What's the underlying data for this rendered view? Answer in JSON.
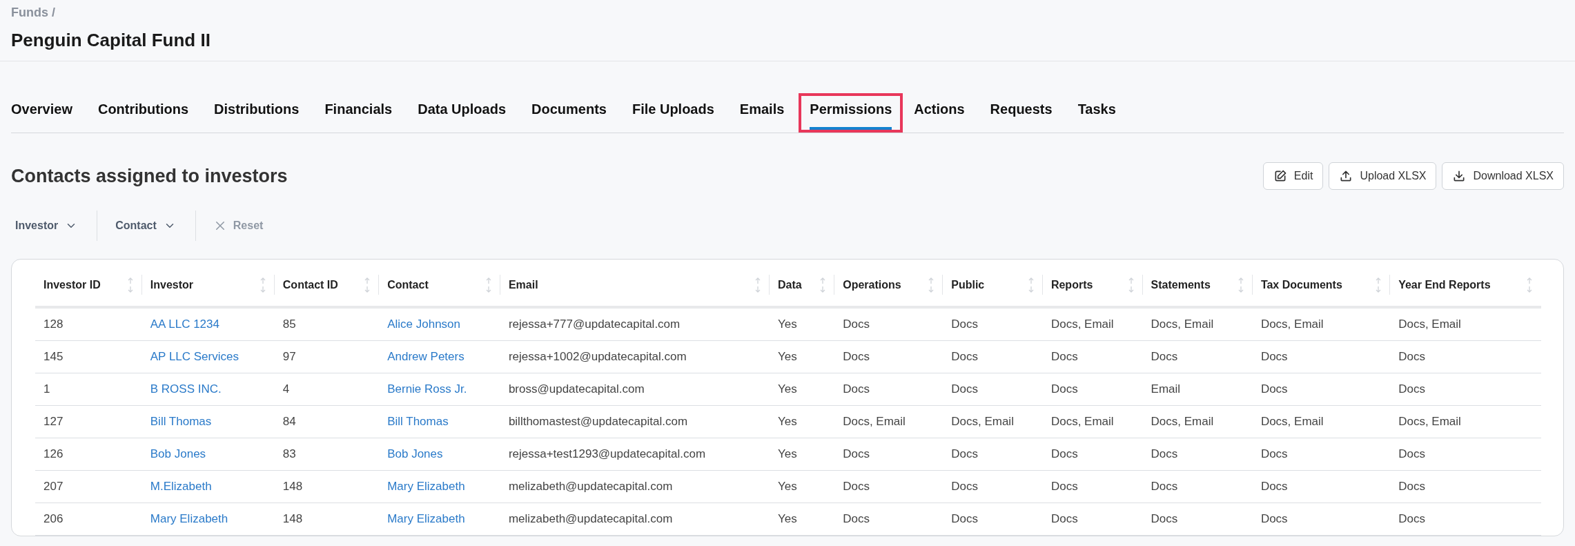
{
  "breadcrumb": "Funds /",
  "title": "Penguin Capital Fund II",
  "tabs": [
    {
      "label": "Overview",
      "selected": false,
      "highlighted": false
    },
    {
      "label": "Contributions",
      "selected": false,
      "highlighted": false
    },
    {
      "label": "Distributions",
      "selected": false,
      "highlighted": false
    },
    {
      "label": "Financials",
      "selected": false,
      "highlighted": false
    },
    {
      "label": "Data Uploads",
      "selected": false,
      "highlighted": false
    },
    {
      "label": "Documents",
      "selected": false,
      "highlighted": false
    },
    {
      "label": "File Uploads",
      "selected": false,
      "highlighted": false
    },
    {
      "label": "Emails",
      "selected": false,
      "highlighted": false
    },
    {
      "label": "Permissions",
      "selected": true,
      "highlighted": true
    },
    {
      "label": "Actions",
      "selected": false,
      "highlighted": false
    },
    {
      "label": "Requests",
      "selected": false,
      "highlighted": false
    },
    {
      "label": "Tasks",
      "selected": false,
      "highlighted": false
    }
  ],
  "section_title": "Contacts assigned to investors",
  "actions": [
    {
      "kind": "edit",
      "label": "Edit"
    },
    {
      "kind": "upload",
      "label": "Upload XLSX"
    },
    {
      "kind": "download",
      "label": "Download XLSX"
    }
  ],
  "filters": [
    {
      "kind": "dropdown",
      "label": "Investor",
      "disabled": false
    },
    {
      "kind": "dropdown",
      "label": "Contact",
      "disabled": false
    },
    {
      "kind": "reset",
      "label": "Reset",
      "disabled": true
    }
  ],
  "table": {
    "columns": [
      {
        "label": "Investor ID",
        "kind": "text"
      },
      {
        "label": "Investor",
        "kind": "link"
      },
      {
        "label": "Contact ID",
        "kind": "text"
      },
      {
        "label": "Contact",
        "kind": "link"
      },
      {
        "label": "Email",
        "kind": "text"
      },
      {
        "label": "Data",
        "kind": "text"
      },
      {
        "label": "Operations",
        "kind": "text"
      },
      {
        "label": "Public",
        "kind": "text"
      },
      {
        "label": "Reports",
        "kind": "text"
      },
      {
        "label": "Statements",
        "kind": "text"
      },
      {
        "label": "Tax Documents",
        "kind": "text"
      },
      {
        "label": "Year End Reports",
        "kind": "text"
      }
    ],
    "rows": [
      [
        "128",
        "AA LLC 1234",
        "85",
        "Alice Johnson",
        "rejessa+777@updatecapital.com",
        "Yes",
        "Docs",
        "Docs",
        "Docs, Email",
        "Docs, Email",
        "Docs, Email",
        "Docs, Email"
      ],
      [
        "145",
        "AP LLC Services",
        "97",
        "Andrew Peters",
        "rejessa+1002@updatecapital.com",
        "Yes",
        "Docs",
        "Docs",
        "Docs",
        "Docs",
        "Docs",
        "Docs"
      ],
      [
        "1",
        "B ROSS INC.",
        "4",
        "Bernie Ross Jr.",
        "bross@updatecapital.com",
        "Yes",
        "Docs",
        "Docs",
        "Docs",
        "Email",
        "Docs",
        "Docs"
      ],
      [
        "127",
        "Bill Thomas",
        "84",
        "Bill Thomas",
        "billthomastest@updatecapital.com",
        "Yes",
        "Docs, Email",
        "Docs, Email",
        "Docs, Email",
        "Docs, Email",
        "Docs, Email",
        "Docs, Email"
      ],
      [
        "126",
        "Bob Jones",
        "83",
        "Bob Jones",
        "rejessa+test1293@updatecapital.com",
        "Yes",
        "Docs",
        "Docs",
        "Docs",
        "Docs",
        "Docs",
        "Docs"
      ],
      [
        "207",
        "M.Elizabeth",
        "148",
        "Mary Elizabeth",
        "melizabeth@updatecapital.com",
        "Yes",
        "Docs",
        "Docs",
        "Docs",
        "Docs",
        "Docs",
        "Docs"
      ],
      [
        "206",
        "Mary Elizabeth",
        "148",
        "Mary Elizabeth",
        "melizabeth@updatecapital.com",
        "Yes",
        "Docs",
        "Docs",
        "Docs",
        "Docs",
        "Docs",
        "Docs"
      ]
    ]
  }
}
